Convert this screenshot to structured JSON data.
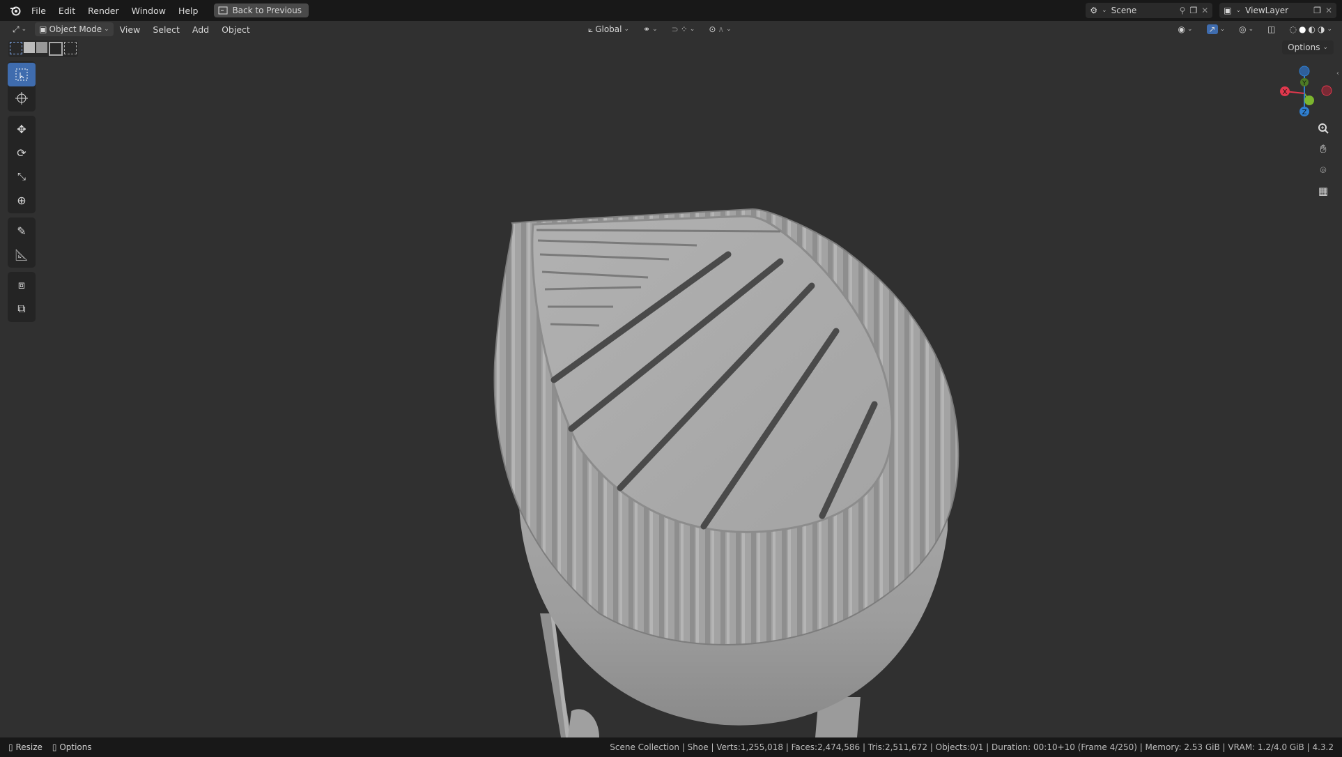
{
  "menu": [
    "File",
    "Edit",
    "Render",
    "Window",
    "Help"
  ],
  "back_button": "Back to Previous",
  "scene": {
    "name": "Scene"
  },
  "view_layer": {
    "name": "ViewLayer"
  },
  "header": {
    "mode": "Object Mode",
    "menus": [
      "View",
      "Select",
      "Add",
      "Object"
    ],
    "transform_orientation": "Global"
  },
  "options_label": "Options",
  "gizmo": {
    "x": "X",
    "y": "Y",
    "z": "Z"
  },
  "status": {
    "left": [
      "Resize",
      "Options"
    ],
    "right": "Scene Collection | Shoe | Verts:1,255,018 | Faces:2,474,586 | Tris:2,511,672 | Objects:0/1 | Duration: 00:10+10 (Frame 4/250) | Memory: 2.53 GiB | VRAM: 1.2/4.0 GiB | 4.3.2"
  },
  "colors": {
    "topbar": "#181818",
    "viewport": "#303030",
    "active_tool": "#3f6cae",
    "axis_x": "#e0384d",
    "axis_y": "#7cb52e",
    "axis_z": "#2f7fd0"
  }
}
